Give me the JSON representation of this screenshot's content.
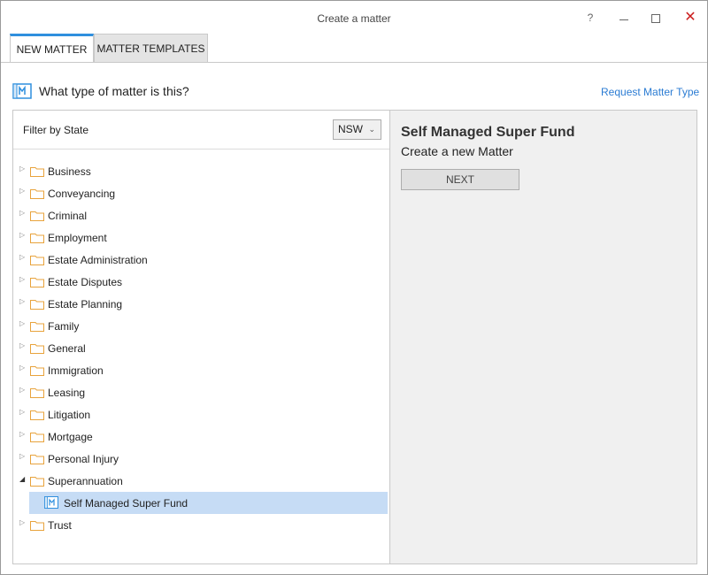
{
  "window": {
    "title": "Create a matter",
    "help_label": "?",
    "close_label": "✕"
  },
  "tabs": [
    {
      "label": "NEW MATTER",
      "active": true
    },
    {
      "label": "MATTER TEMPLATES",
      "active": false
    }
  ],
  "header": {
    "question": "What type of matter is this?",
    "request_link": "Request Matter Type",
    "icon": "matter-icon"
  },
  "filter": {
    "label": "Filter by State",
    "state": "NSW",
    "chevron": "⌄"
  },
  "tree": {
    "collapsed_glyph": "▷",
    "expanded_glyph": "◢",
    "items": [
      {
        "label": "Business",
        "expanded": false
      },
      {
        "label": "Conveyancing",
        "expanded": false
      },
      {
        "label": "Criminal",
        "expanded": false
      },
      {
        "label": "Employment",
        "expanded": false
      },
      {
        "label": "Estate Administration",
        "expanded": false
      },
      {
        "label": "Estate Disputes",
        "expanded": false
      },
      {
        "label": "Estate Planning",
        "expanded": false
      },
      {
        "label": "Family",
        "expanded": false
      },
      {
        "label": "General",
        "expanded": false
      },
      {
        "label": "Immigration",
        "expanded": false
      },
      {
        "label": "Leasing",
        "expanded": false
      },
      {
        "label": "Litigation",
        "expanded": false
      },
      {
        "label": "Mortgage",
        "expanded": false
      },
      {
        "label": "Personal Injury",
        "expanded": false
      },
      {
        "label": "Superannuation",
        "expanded": true,
        "children": [
          {
            "label": "Self Managed Super Fund",
            "selected": true
          }
        ]
      },
      {
        "label": "Trust",
        "expanded": false
      }
    ]
  },
  "detail": {
    "title": "Self Managed Super Fund",
    "subtitle": "Create a new Matter",
    "next_label": "NEXT"
  },
  "colors": {
    "accent": "#2f8fde",
    "link": "#2b7cd3",
    "folder": "#e8a33c",
    "selection": "#c6dcf5",
    "close": "#cc1f1f"
  }
}
